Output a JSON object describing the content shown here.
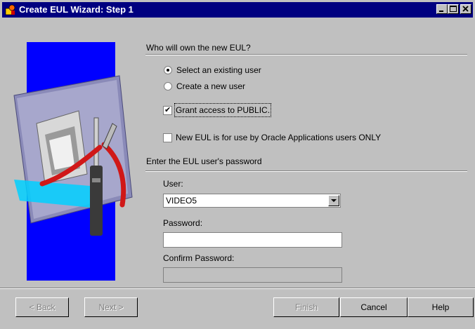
{
  "window": {
    "title": "Create EUL Wizard: Step 1",
    "controls": [
      "minimize-icon",
      "maximize-icon",
      "close-icon"
    ]
  },
  "ownership": {
    "heading": "Who will own the new EUL?",
    "options": [
      {
        "label": "Select an existing user",
        "selected": true
      },
      {
        "label": "Create a new user",
        "selected": false
      }
    ],
    "grant_public": {
      "label": "Grant access to PUBLIC.",
      "checked": true
    },
    "oracle_apps": {
      "label": "New EUL is for use by Oracle Applications users ONLY",
      "checked": false
    }
  },
  "password_section": {
    "heading": "Enter the EUL user's password",
    "user_label": "User:",
    "user_value": "VIDEO5",
    "password_label": "Password:",
    "password_value": "",
    "confirm_label": "Confirm Password:",
    "confirm_value": ""
  },
  "buttons": {
    "back": "< Back",
    "next": "Next >",
    "finish": "Finish",
    "cancel": "Cancel",
    "help": "Help"
  },
  "colors": {
    "title_bar": "#000080",
    "dialog_bg": "#c0c0c0",
    "illustration_bg": "#0000ff"
  }
}
